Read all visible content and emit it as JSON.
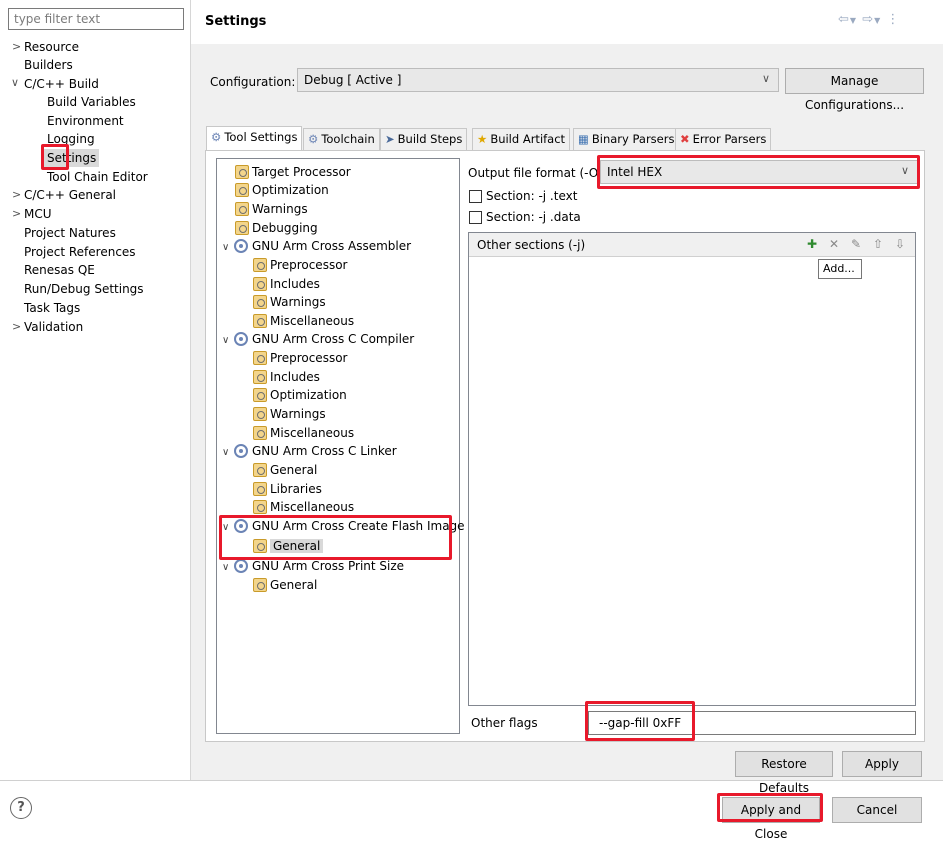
{
  "nav": {
    "filter_placeholder": "type filter text",
    "items": [
      {
        "label": "Resource",
        "expander": "collapsed"
      },
      {
        "label": "Builders"
      },
      {
        "label": "C/C++ Build",
        "expander": "expanded"
      },
      {
        "label": "Build Variables"
      },
      {
        "label": "Environment"
      },
      {
        "label": "Logging"
      },
      {
        "label": "Settings",
        "selected": true
      },
      {
        "label": "Tool Chain Editor"
      },
      {
        "label": "C/C++ General",
        "expander": "collapsed"
      },
      {
        "label": "MCU",
        "expander": "collapsed"
      },
      {
        "label": "Project Natures"
      },
      {
        "label": "Project References"
      },
      {
        "label": "Renesas QE"
      },
      {
        "label": "Run/Debug Settings"
      },
      {
        "label": "Task Tags"
      },
      {
        "label": "Validation",
        "expander": "collapsed"
      }
    ]
  },
  "header": {
    "title": "Settings",
    "nav_icons": [
      "back-arrow-icon",
      "dropdown-icon",
      "forward-arrow-icon",
      "dropdown-icon",
      "view-menu-icon"
    ]
  },
  "config": {
    "label": "Configuration:",
    "value": "Debug  [ Active ]",
    "manage_button": "Manage Configurations..."
  },
  "tabs": [
    {
      "label": "Tool Settings",
      "active": true,
      "icon": "gear-icon"
    },
    {
      "label": "Toolchain",
      "icon": "gear-icon"
    },
    {
      "label": "Build Steps",
      "icon": "build-steps-icon"
    },
    {
      "label": "Build Artifact",
      "icon": "trophy-icon"
    },
    {
      "label": "Binary Parsers",
      "icon": "binary-icon"
    },
    {
      "label": "Error Parsers",
      "icon": "error-icon"
    }
  ],
  "tree": [
    {
      "label": "Target Processor",
      "level": 1,
      "icon": "settings-page-icon"
    },
    {
      "label": "Optimization",
      "level": 1,
      "icon": "settings-page-icon"
    },
    {
      "label": "Warnings",
      "level": 1,
      "icon": "settings-page-icon"
    },
    {
      "label": "Debugging",
      "level": 1,
      "icon": "settings-page-icon"
    },
    {
      "label": "GNU Arm Cross Assembler",
      "level": 0,
      "icon": "tool-icon"
    },
    {
      "label": "Preprocessor",
      "level": 2,
      "icon": "settings-page-icon"
    },
    {
      "label": "Includes",
      "level": 2,
      "icon": "settings-page-icon"
    },
    {
      "label": "Warnings",
      "level": 2,
      "icon": "settings-page-icon"
    },
    {
      "label": "Miscellaneous",
      "level": 2,
      "icon": "settings-page-icon"
    },
    {
      "label": "GNU Arm Cross C Compiler",
      "level": 0,
      "icon": "tool-icon"
    },
    {
      "label": "Preprocessor",
      "level": 2,
      "icon": "settings-page-icon"
    },
    {
      "label": "Includes",
      "level": 2,
      "icon": "settings-page-icon"
    },
    {
      "label": "Optimization",
      "level": 2,
      "icon": "settings-page-icon"
    },
    {
      "label": "Warnings",
      "level": 2,
      "icon": "settings-page-icon"
    },
    {
      "label": "Miscellaneous",
      "level": 2,
      "icon": "settings-page-icon"
    },
    {
      "label": "GNU Arm Cross C Linker",
      "level": 0,
      "icon": "tool-icon"
    },
    {
      "label": "General",
      "level": 2,
      "icon": "settings-page-icon"
    },
    {
      "label": "Libraries",
      "level": 2,
      "icon": "settings-page-icon"
    },
    {
      "label": "Miscellaneous",
      "level": 2,
      "icon": "settings-page-icon"
    },
    {
      "label": "GNU Arm Cross Create Flash Image",
      "level": 0,
      "icon": "tool-icon"
    },
    {
      "label": "General",
      "level": 2,
      "icon": "settings-page-icon",
      "selected": true
    },
    {
      "label": "GNU Arm Cross Print Size",
      "level": 0,
      "icon": "tool-icon"
    },
    {
      "label": "General",
      "level": 2,
      "icon": "settings-page-icon"
    }
  ],
  "options": {
    "output_format_label": "Output file format (-O)",
    "output_format_value": "Intel HEX",
    "section_text_label": "Section: -j .text",
    "section_text_checked": false,
    "section_data_label": "Section: -j .data",
    "section_data_checked": false,
    "other_sections_label": "Other sections (-j)",
    "toolbar_icons": [
      "add-icon",
      "delete-icon",
      "edit-icon",
      "move-up-icon",
      "move-down-icon"
    ],
    "tooltip": "Add...",
    "other_flags_label": "Other flags",
    "other_flags_value": "--gap-fill 0xFF"
  },
  "buttons": {
    "restore_defaults": "Restore Defaults",
    "apply": "Apply",
    "apply_and_close": "Apply and Close",
    "cancel": "Cancel"
  },
  "colors": {
    "highlight": "#e8192b",
    "panel_bg": "#f0f0f0",
    "selection_bg": "#d9d9d9"
  }
}
